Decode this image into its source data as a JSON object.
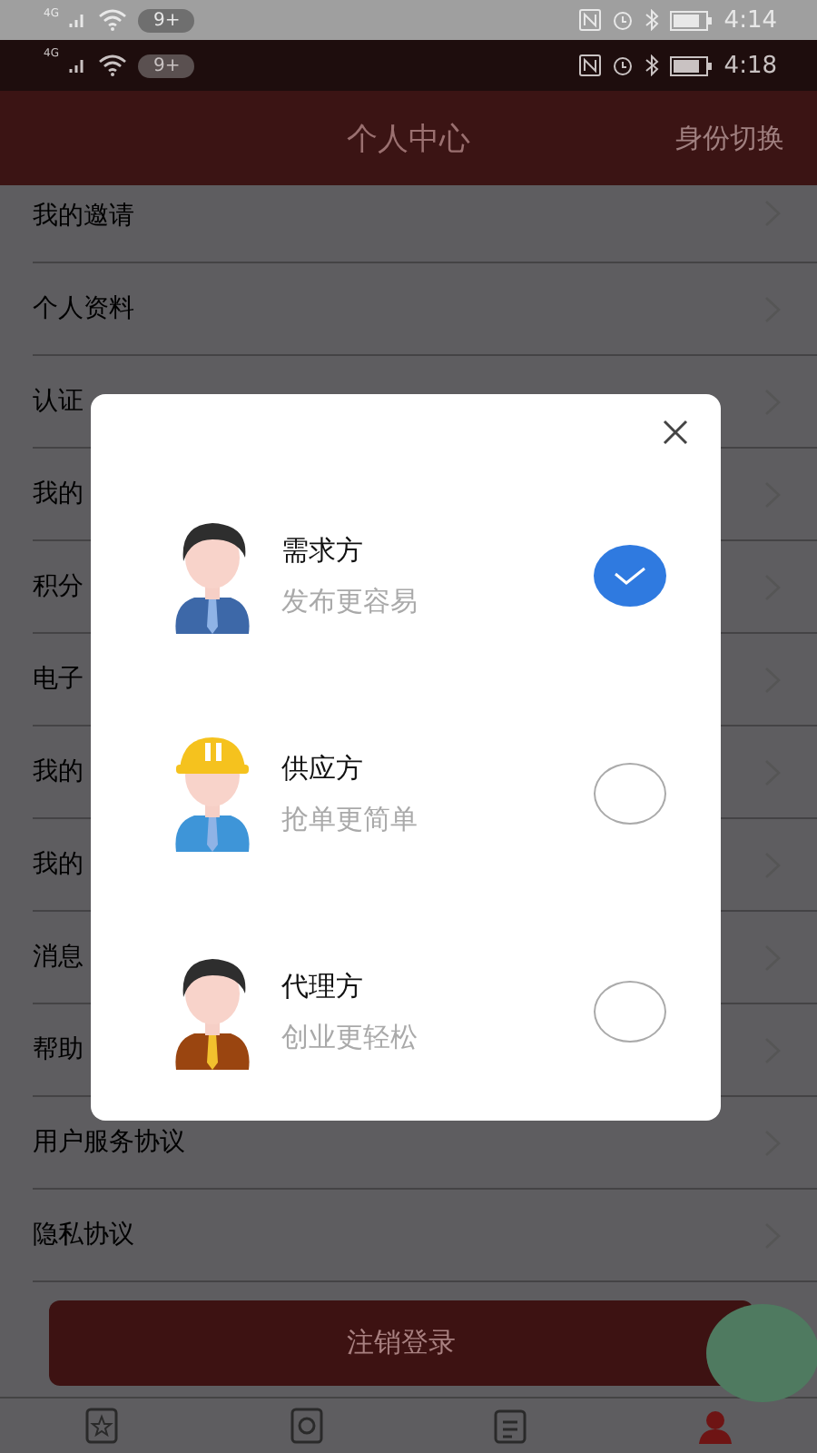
{
  "status_bars": [
    {
      "network": "4G",
      "badge": "9+",
      "time": "4:14"
    },
    {
      "network": "4G",
      "badge": "9+",
      "time": "4:18"
    }
  ],
  "header": {
    "title": "个人中心",
    "action": "身份切换"
  },
  "menu": [
    "我的邀请",
    "个人资料",
    "认证",
    "我的",
    "积分",
    "电子",
    "我的",
    "我的",
    "消息",
    "帮助",
    "用户服务协议",
    "隐私协议"
  ],
  "logout": "注销登录",
  "tabs": [
    {
      "kind": "star",
      "selected": false
    },
    {
      "kind": "picture",
      "selected": false
    },
    {
      "kind": "list",
      "selected": false
    },
    {
      "kind": "person",
      "selected": true
    }
  ],
  "dialog": {
    "options": [
      {
        "kind": "suit",
        "title": "需求方",
        "subtitle": "发布更容易",
        "selected": true
      },
      {
        "kind": "helmet",
        "title": "供应方",
        "subtitle": "抢单更简单",
        "selected": false
      },
      {
        "kind": "vest",
        "title": "代理方",
        "subtitle": "创业更轻松",
        "selected": false
      }
    ]
  }
}
